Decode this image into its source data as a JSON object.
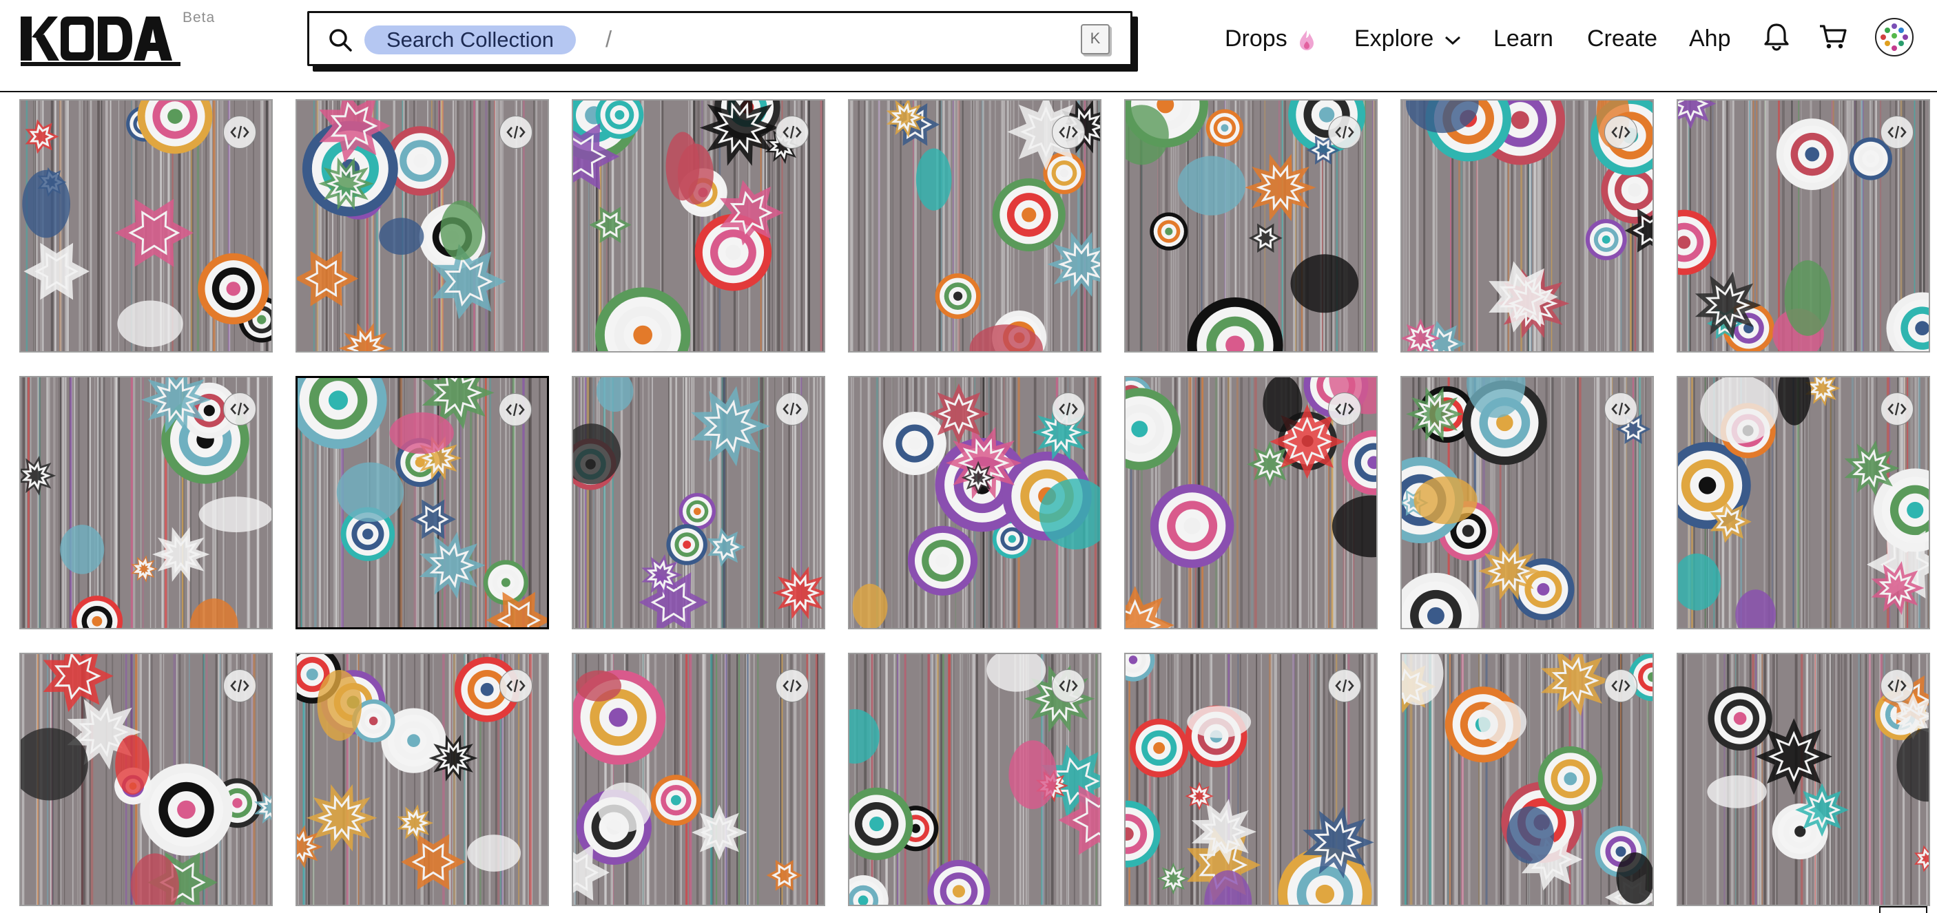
{
  "header": {
    "logo_text": "KODA",
    "beta_label": "Beta",
    "search": {
      "chip_label": "Search Collection",
      "separator": "/",
      "shortcut_key": "K"
    },
    "nav": [
      {
        "label": "Drops",
        "icon": "flame-icon"
      },
      {
        "label": "Explore",
        "icon": "chevron-down-icon"
      },
      {
        "label": "Learn"
      },
      {
        "label": "Create"
      },
      {
        "label": "Ahp"
      }
    ],
    "icons": [
      "bell-icon",
      "cart-icon",
      "avatar"
    ]
  },
  "grid": {
    "columns": 7,
    "rows": 3,
    "tile_badge_icon": "code-icon",
    "selected_tile_index": 8
  },
  "colors": {
    "search_chip": "#b5c7f2",
    "flame": "#f0a4d2",
    "border": "#111111",
    "tile_border": "#9d9d9d"
  }
}
